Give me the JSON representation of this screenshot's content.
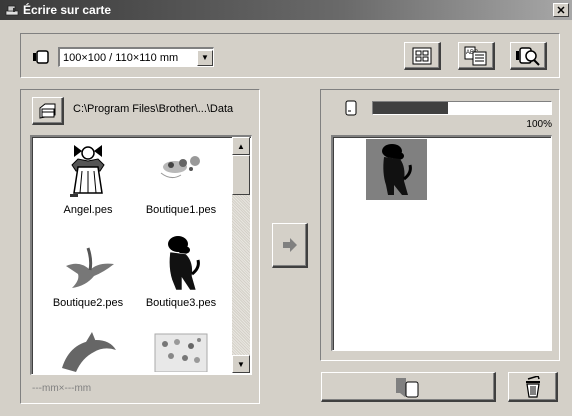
{
  "window": {
    "title": "Écrire sur carte",
    "close_label": "✕"
  },
  "toolbar": {
    "card_size": "100×100 / 110×110 mm",
    "buttons": [
      "grid-view-icon",
      "card-info-icon",
      "card-search-icon"
    ]
  },
  "left_panel": {
    "path": "C:\\Program Files\\Brother\\...\\Data",
    "files": [
      {
        "name": "Angel.pes"
      },
      {
        "name": "Boutique1.pes"
      },
      {
        "name": "Boutique2.pes"
      },
      {
        "name": "Boutique3.pes"
      },
      {
        "name": "",
        "icon": "dolphin-thumbnail"
      },
      {
        "name": "",
        "icon": "floral-pattern-thumbnail"
      }
    ],
    "size_display": "---mm×---mm"
  },
  "right_panel": {
    "progress_value": 0.42,
    "progress_label": "100%"
  },
  "colors": {
    "accent": "#404040",
    "face": "#d4d0c8"
  }
}
